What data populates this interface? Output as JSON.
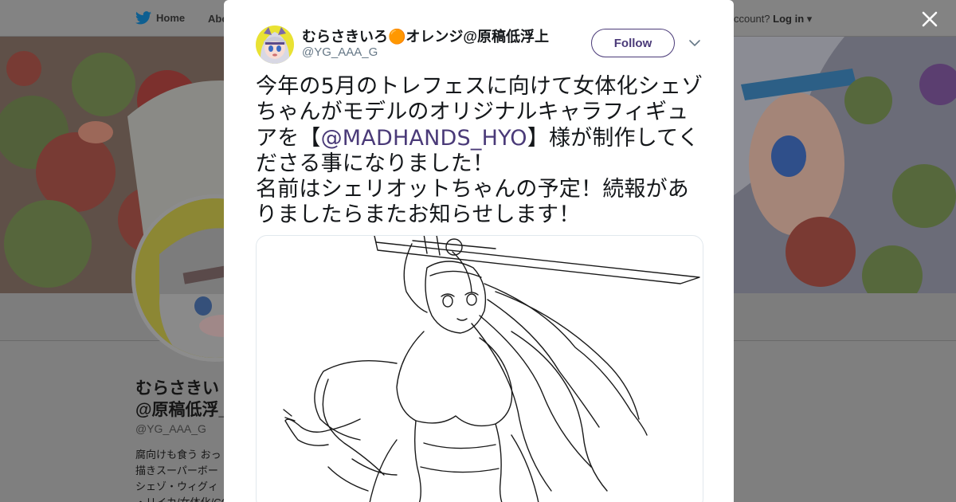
{
  "nav": {
    "home_label": "Home",
    "about_label": "Abo",
    "account_prompt": "ccount?",
    "login_label": "Log in"
  },
  "profile": {
    "name_line1": "むらさきい",
    "name_line2": "@原稿低浮_",
    "handle": "@YG_AAA_G",
    "bio_lines": [
      "腐向けも食う おっ",
      "描きスーパーボー",
      "シェゾ・ウィグィ",
      "・リイカ/女体化/CO"
    ]
  },
  "tweet": {
    "author_name": "むらさきいろ🟠オレンジ@原稿低浮上",
    "author_handle": "@YG_AAA_G",
    "follow_label": "Follow",
    "text_before": "今年の5月のトレフェスに向けて女体化シェゾちゃんがモデルのオリジナルキャラフィギュアを【",
    "mention": "@MADHANDS_HYO",
    "text_after": "】様が制作してくださる事になりました！\n名前はシェリオットちゃんの予定！続報がありましたらまたお知らせします！"
  },
  "colors": {
    "accent": "#4a3a78",
    "twitter_blue": "#1da1f2",
    "overlay": "#7f7f7f",
    "text": "#14171a",
    "subtext": "#657786"
  },
  "icons": {
    "nav_logo": "twitter-bird-icon",
    "close": "close-icon",
    "caret": "chevron-down-icon"
  }
}
